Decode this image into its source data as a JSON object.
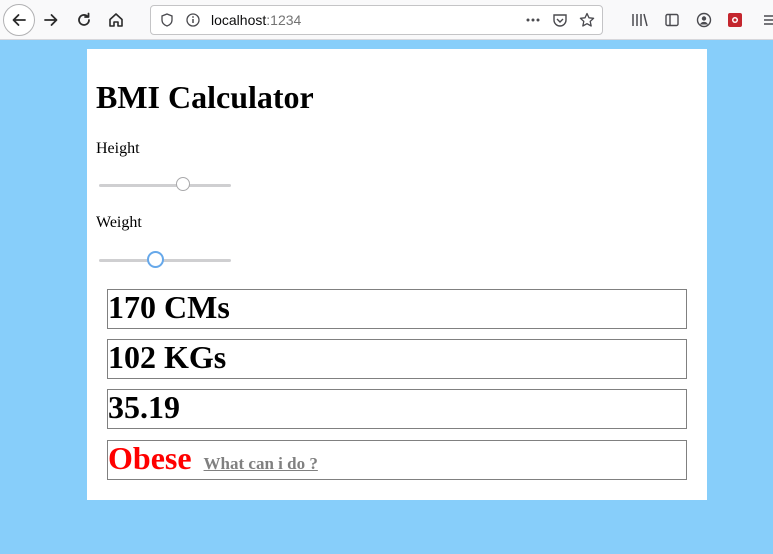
{
  "browser": {
    "url_host": "localhost",
    "url_port": ":1234"
  },
  "page": {
    "title": "BMI Calculator",
    "height_label": "Height",
    "weight_label": "Weight",
    "height_slider_level": 0.65,
    "weight_slider_level": 0.42,
    "height_display": "170 CMs",
    "weight_display": "102 KGs",
    "bmi_value": "35.19",
    "status_text": "Obese",
    "help_link_text": "What can i do ?",
    "status_color": "#ff0000",
    "background_color": "#87cefa"
  }
}
